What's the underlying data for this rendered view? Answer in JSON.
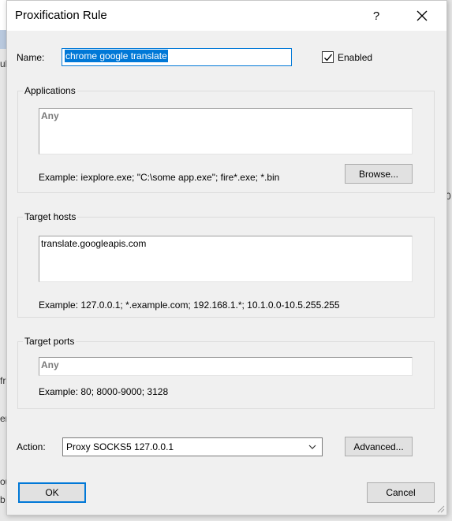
{
  "background": {
    "left_fragments": [
      "ul",
      "fr",
      "en",
      "ou",
      "b"
    ],
    "right_fragments": [
      "0"
    ]
  },
  "dialog": {
    "title": "Proxification Rule",
    "help_glyph": "?",
    "name_label": "Name:",
    "name_value": "chrome google translate",
    "enabled_label": "Enabled",
    "enabled_checked": true,
    "applications": {
      "group_title": "Applications",
      "value": "Any",
      "example": "Example: iexplore.exe; \"C:\\some app.exe\"; fire*.exe; *.bin",
      "browse_label": "Browse..."
    },
    "target_hosts": {
      "group_title": "Target hosts",
      "value": "translate.googleapis.com",
      "example": "Example: 127.0.0.1; *.example.com; 192.168.1.*; 10.1.0.0-10.5.255.255"
    },
    "target_ports": {
      "group_title": "Target ports",
      "value": "Any",
      "example": "Example: 80; 8000-9000; 3128"
    },
    "action_label": "Action:",
    "action_value": "Proxy SOCKS5 127.0.0.1",
    "advanced_label": "Advanced...",
    "ok_label": "OK",
    "cancel_label": "Cancel"
  },
  "colors": {
    "accent": "#0078d7",
    "dialog_bg": "#f0f0f0",
    "button_bg": "#e1e1e1"
  }
}
